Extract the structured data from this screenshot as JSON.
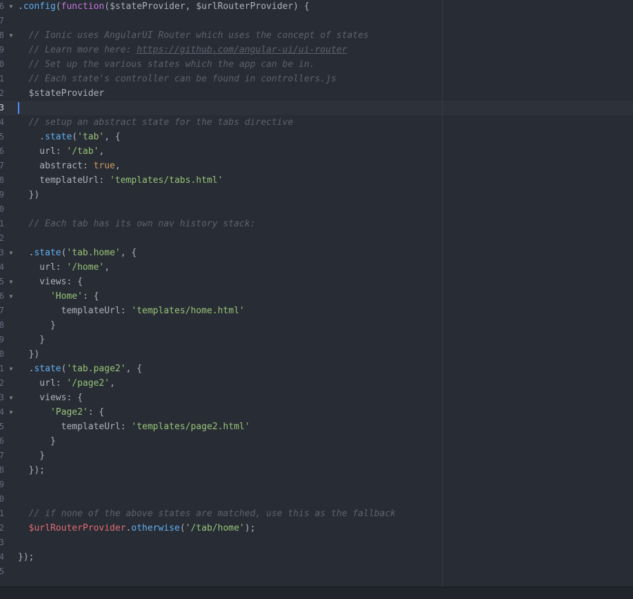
{
  "editor": {
    "lines": [
      {
        "num": "6",
        "fold": true,
        "tokens": [
          {
            "t": ".",
            "c": "plain"
          },
          {
            "t": "config",
            "c": "func"
          },
          {
            "t": "(",
            "c": "plain"
          },
          {
            "t": "function",
            "c": "keyword"
          },
          {
            "t": "($stateProvider, $urlRouterProvider) {",
            "c": "plain"
          }
        ]
      },
      {
        "num": "7",
        "tokens": []
      },
      {
        "num": "8",
        "fold": true,
        "tokens": [
          {
            "t": "  // Ionic uses AngularUI Router which uses the concept of states",
            "c": "comment"
          }
        ]
      },
      {
        "num": "9",
        "tokens": [
          {
            "t": "  // Learn more here: ",
            "c": "comment"
          },
          {
            "t": "https://github.com/angular-ui/ui-router",
            "c": "link"
          }
        ]
      },
      {
        "num": "0",
        "tokens": [
          {
            "t": "  // Set up the various states which the app can be in.",
            "c": "comment"
          }
        ]
      },
      {
        "num": "1",
        "tokens": [
          {
            "t": "  // Each state's controller can be found in controllers.js",
            "c": "comment"
          }
        ]
      },
      {
        "num": "2",
        "tokens": [
          {
            "t": "  $stateProvider",
            "c": "plain"
          }
        ]
      },
      {
        "num": "3",
        "active": true,
        "cursor": true,
        "tokens": []
      },
      {
        "num": "4",
        "tokens": [
          {
            "t": "  // setup an abstract state for the tabs directive",
            "c": "comment"
          }
        ]
      },
      {
        "num": "5",
        "tokens": [
          {
            "t": "    .",
            "c": "plain"
          },
          {
            "t": "state",
            "c": "func"
          },
          {
            "t": "(",
            "c": "plain"
          },
          {
            "t": "'tab'",
            "c": "string"
          },
          {
            "t": ", {",
            "c": "plain"
          }
        ]
      },
      {
        "num": "6",
        "tokens": [
          {
            "t": "    url: ",
            "c": "plain"
          },
          {
            "t": "'/tab'",
            "c": "string"
          },
          {
            "t": ",",
            "c": "plain"
          }
        ]
      },
      {
        "num": "7",
        "tokens": [
          {
            "t": "    abstract: ",
            "c": "plain"
          },
          {
            "t": "true",
            "c": "bool"
          },
          {
            "t": ",",
            "c": "plain"
          }
        ]
      },
      {
        "num": "8",
        "tokens": [
          {
            "t": "    templateUrl: ",
            "c": "plain"
          },
          {
            "t": "'templates/tabs.html'",
            "c": "string"
          }
        ]
      },
      {
        "num": "9",
        "tokens": [
          {
            "t": "  })",
            "c": "plain"
          }
        ]
      },
      {
        "num": "0",
        "tokens": []
      },
      {
        "num": "1",
        "tokens": [
          {
            "t": "  // Each tab has its own nav history stack:",
            "c": "comment"
          }
        ]
      },
      {
        "num": "2",
        "tokens": []
      },
      {
        "num": "3",
        "fold": true,
        "tokens": [
          {
            "t": "  .",
            "c": "plain"
          },
          {
            "t": "state",
            "c": "func"
          },
          {
            "t": "(",
            "c": "plain"
          },
          {
            "t": "'tab.home'",
            "c": "string"
          },
          {
            "t": ", {",
            "c": "plain"
          }
        ]
      },
      {
        "num": "4",
        "tokens": [
          {
            "t": "    url: ",
            "c": "plain"
          },
          {
            "t": "'/home'",
            "c": "string"
          },
          {
            "t": ",",
            "c": "plain"
          }
        ]
      },
      {
        "num": "5",
        "fold": true,
        "tokens": [
          {
            "t": "    views: {",
            "c": "plain"
          }
        ]
      },
      {
        "num": "6",
        "fold": true,
        "tokens": [
          {
            "t": "      ",
            "c": "plain"
          },
          {
            "t": "'Home'",
            "c": "string"
          },
          {
            "t": ": {",
            "c": "plain"
          }
        ]
      },
      {
        "num": "7",
        "tokens": [
          {
            "t": "        templateUrl: ",
            "c": "plain"
          },
          {
            "t": "'templates/home.html'",
            "c": "string"
          }
        ]
      },
      {
        "num": "8",
        "tokens": [
          {
            "t": "      }",
            "c": "plain"
          }
        ]
      },
      {
        "num": "9",
        "tokens": [
          {
            "t": "    }",
            "c": "plain"
          }
        ]
      },
      {
        "num": "0",
        "tokens": [
          {
            "t": "  })",
            "c": "plain"
          }
        ]
      },
      {
        "num": "1",
        "fold": true,
        "tokens": [
          {
            "t": "  .",
            "c": "plain"
          },
          {
            "t": "state",
            "c": "func"
          },
          {
            "t": "(",
            "c": "plain"
          },
          {
            "t": "'tab.page2'",
            "c": "string"
          },
          {
            "t": ", {",
            "c": "plain"
          }
        ]
      },
      {
        "num": "2",
        "tokens": [
          {
            "t": "    url: ",
            "c": "plain"
          },
          {
            "t": "'/page2'",
            "c": "string"
          },
          {
            "t": ",",
            "c": "plain"
          }
        ]
      },
      {
        "num": "3",
        "fold": true,
        "tokens": [
          {
            "t": "    views: {",
            "c": "plain"
          }
        ]
      },
      {
        "num": "4",
        "fold": true,
        "tokens": [
          {
            "t": "      ",
            "c": "plain"
          },
          {
            "t": "'Page2'",
            "c": "string"
          },
          {
            "t": ": {",
            "c": "plain"
          }
        ]
      },
      {
        "num": "5",
        "tokens": [
          {
            "t": "        templateUrl: ",
            "c": "plain"
          },
          {
            "t": "'templates/page2.html'",
            "c": "string"
          }
        ]
      },
      {
        "num": "6",
        "tokens": [
          {
            "t": "      }",
            "c": "plain"
          }
        ]
      },
      {
        "num": "7",
        "tokens": [
          {
            "t": "    }",
            "c": "plain"
          }
        ]
      },
      {
        "num": "8",
        "tokens": [
          {
            "t": "  });",
            "c": "plain"
          }
        ]
      },
      {
        "num": "9",
        "tokens": []
      },
      {
        "num": "0",
        "tokens": []
      },
      {
        "num": "1",
        "tokens": [
          {
            "t": "  // if none of the above states are matched, use this as the fallback",
            "c": "comment"
          }
        ]
      },
      {
        "num": "2",
        "tokens": [
          {
            "t": "  ",
            "c": "plain"
          },
          {
            "t": "$urlRouterProvider",
            "c": "var"
          },
          {
            "t": ".",
            "c": "plain"
          },
          {
            "t": "otherwise",
            "c": "func"
          },
          {
            "t": "(",
            "c": "plain"
          },
          {
            "t": "'/tab/home'",
            "c": "string"
          },
          {
            "t": ");",
            "c": "plain"
          }
        ]
      },
      {
        "num": "3",
        "tokens": []
      },
      {
        "num": "4",
        "tokens": [
          {
            "t": "});",
            "c": "plain"
          }
        ]
      },
      {
        "num": "5",
        "tokens": []
      }
    ]
  },
  "colors": {
    "background": "#282c34",
    "gutter_text": "#636d83",
    "comment": "#5c6370",
    "string": "#98c379",
    "function": "#61afef",
    "keyword": "#c678dd",
    "boolean": "#d19a66",
    "variable": "#e06c75",
    "plain": "#abb2bf",
    "cursor": "#528bff"
  },
  "icons": {
    "fold": "chevron-down-icon"
  }
}
